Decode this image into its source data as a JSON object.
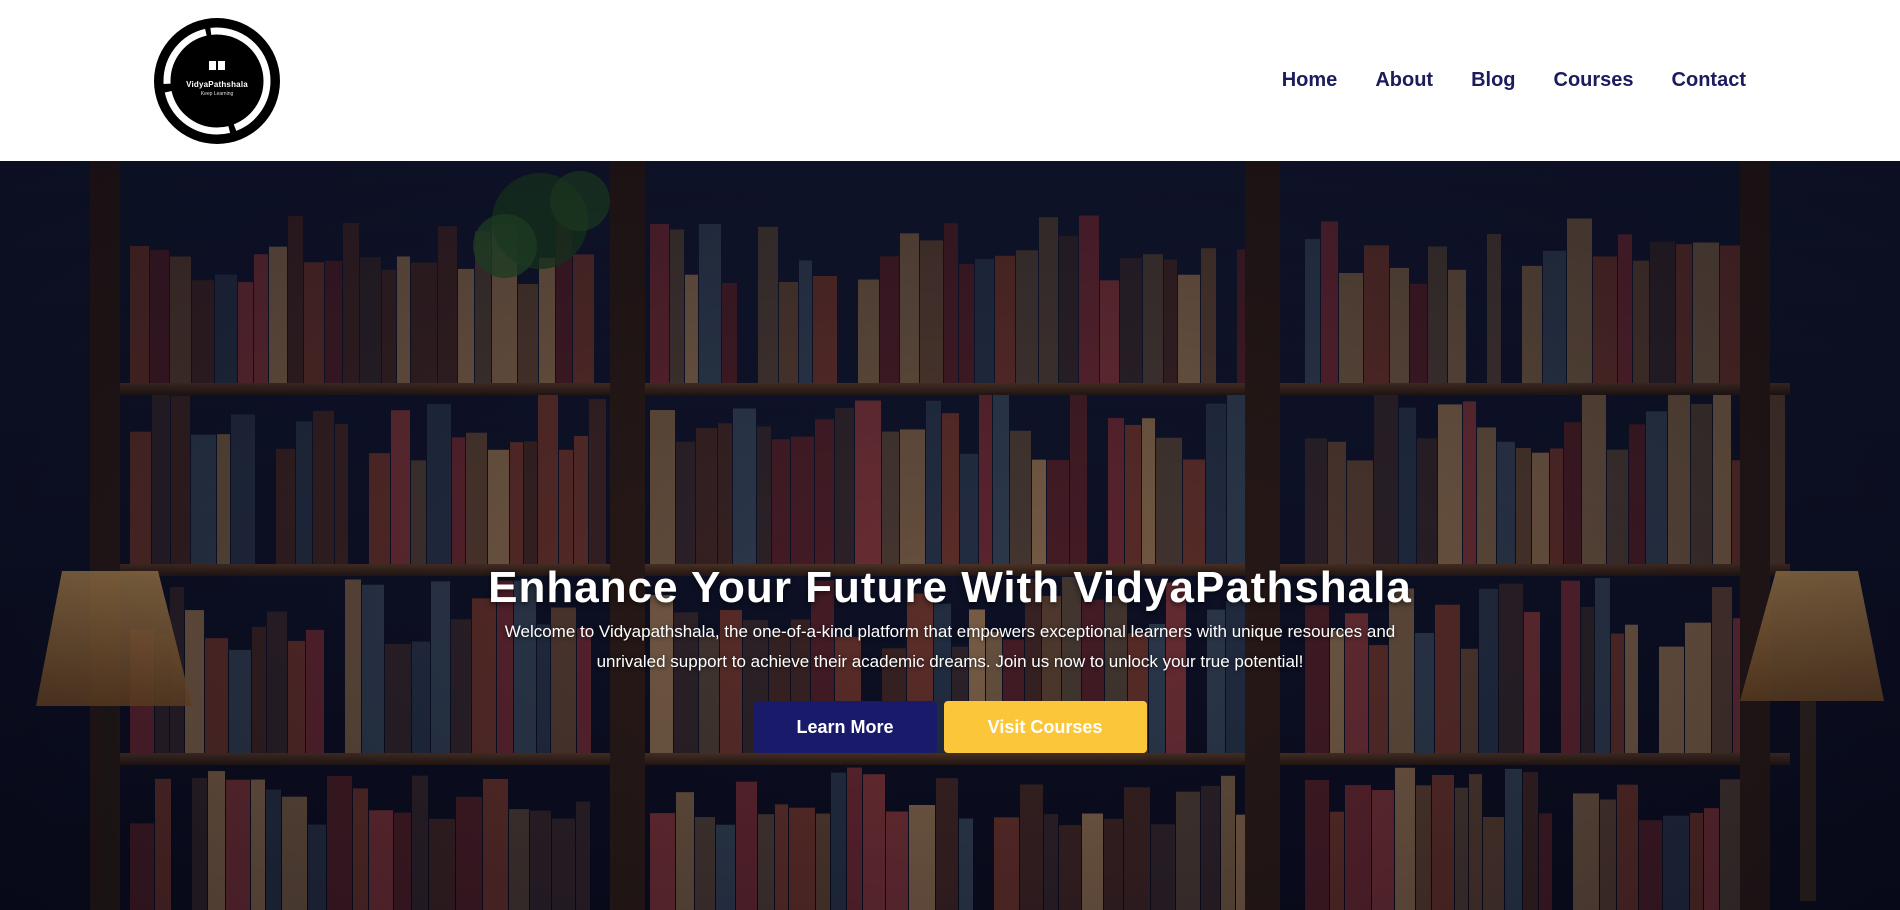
{
  "header": {
    "logo": {
      "name": "VidyaPathshala",
      "tagline": "Keep Learning"
    },
    "nav": [
      {
        "label": "Home"
      },
      {
        "label": "About"
      },
      {
        "label": "Blog"
      },
      {
        "label": "Courses"
      },
      {
        "label": "Contact"
      }
    ]
  },
  "hero": {
    "title": "Enhance Your Future With VidyaPathshala",
    "subtitle": "Welcome to Vidyapathshala, the one-of-a-kind platform that empowers exceptional learners with unique resources and unrivaled support to achieve their academic dreams. Join us now to unlock your true potential!",
    "buttons": {
      "primary": "Learn More",
      "secondary": "Visit Courses"
    }
  },
  "colors": {
    "nav_text": "#1b1b5e",
    "primary_button": "#1a1a6b",
    "secondary_button": "#fcc63a",
    "hero_background": "#0d1025"
  }
}
